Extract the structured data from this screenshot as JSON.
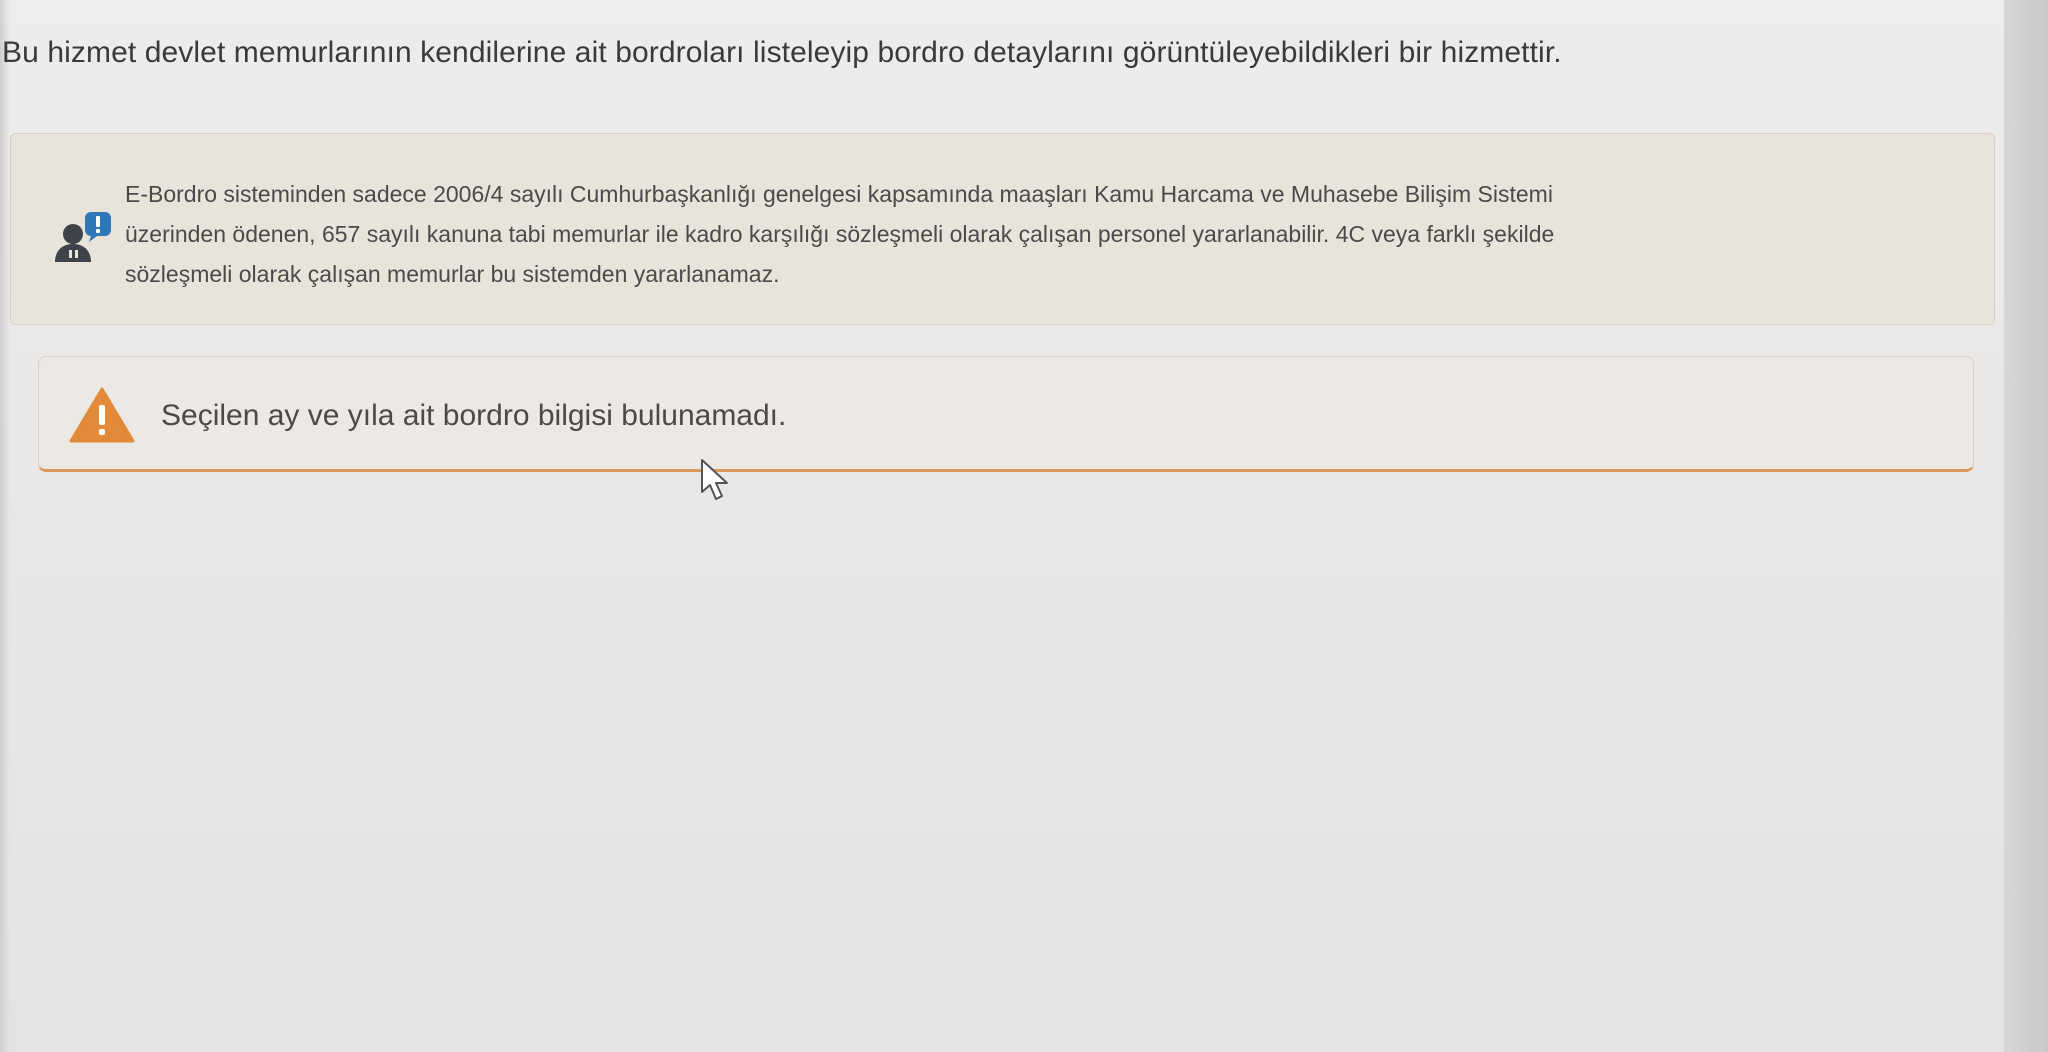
{
  "intro_text": "Bu hizmet devlet memurlarının kendilerine ait bordroları listeleyip bordro detaylarını görüntüleyebildikleri bir hizmettir.",
  "info_box": {
    "icon": "user-alert-icon",
    "lines": [
      "E-Bordro sisteminden sadece 2006/4 sayılı Cumhurbaşkanlığı genelgesi kapsamında maaşları Kamu Harcama ve Muhasebe Bilişim Sistemi",
      "üzerinden ödenen, 657 sayılı kanuna tabi memurlar ile kadro karşılığı sözleşmeli olarak çalışan personel yararlanabilir. 4C veya farklı şekilde",
      "sözleşmeli olarak çalışan memurlar bu sistemden yararlanamaz."
    ]
  },
  "warning_box": {
    "icon": "warning-triangle-icon",
    "message": "Seçilen ay ve yıla ait bordro bilgisi bulunamadı."
  },
  "colors": {
    "info_bg": "#e8e4d9",
    "warning_bg": "#ece8e4",
    "warning_accent": "#e08a3a",
    "icon_dark": "#3d4348",
    "icon_badge": "#2f78b8"
  }
}
